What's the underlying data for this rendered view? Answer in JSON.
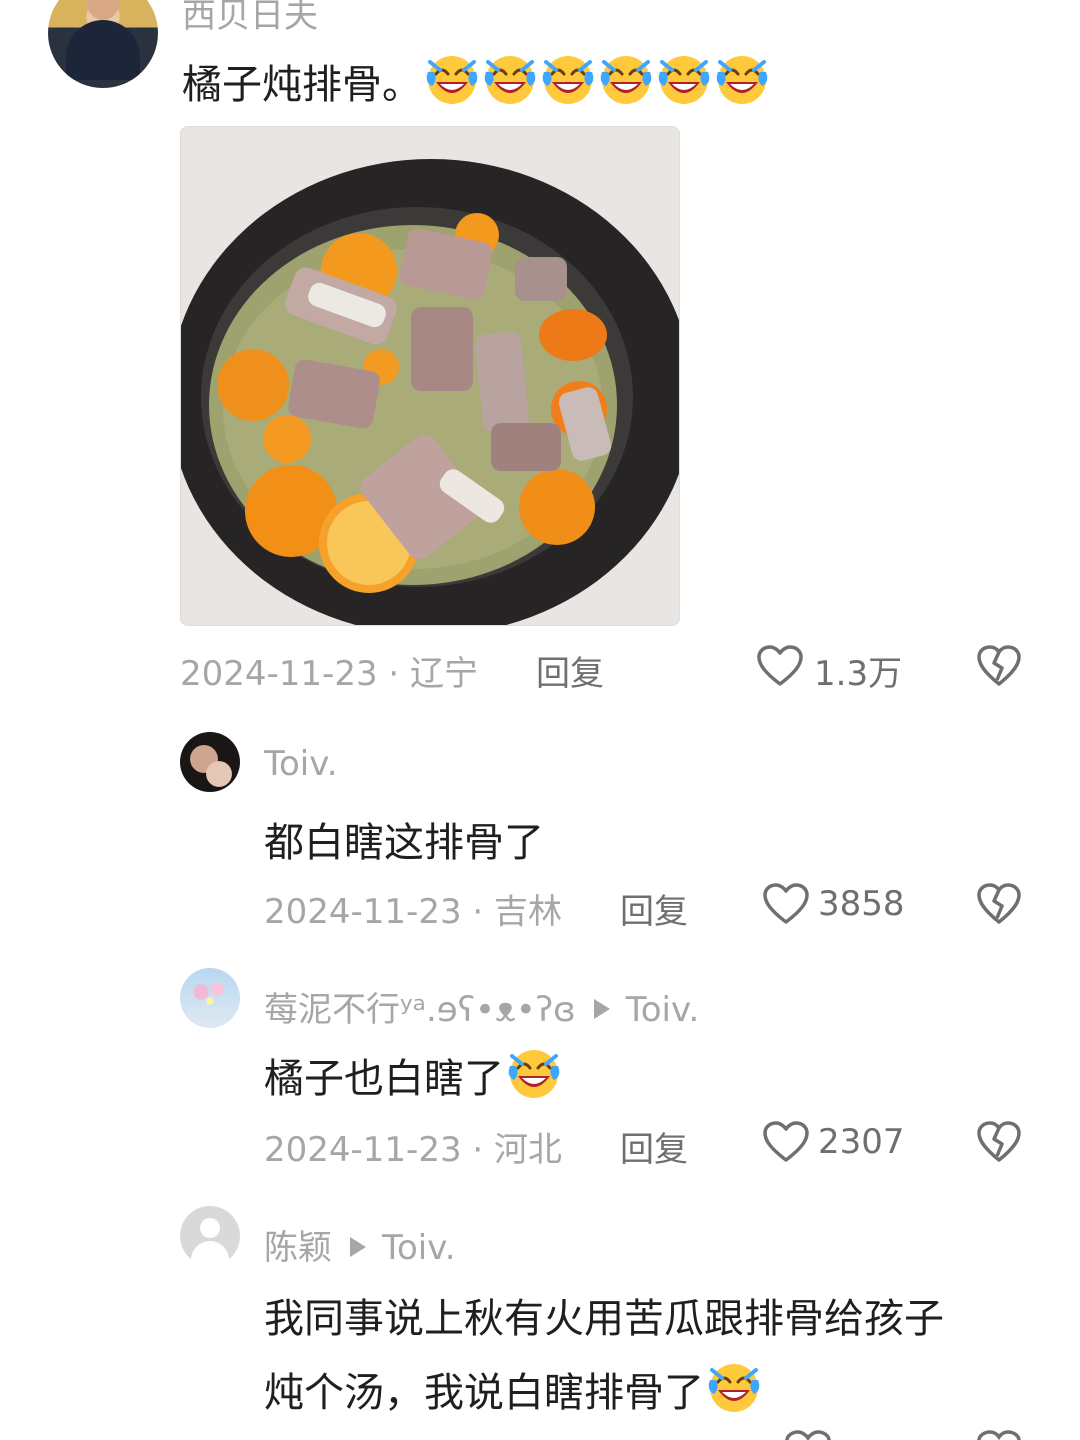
{
  "comments": [
    {
      "username": "西贝日夫",
      "text": "橘子炖排骨。",
      "emoji_count": 6,
      "emoji": "laughing-crying-emoji",
      "date_location": "2024-11-23 · 辽宁",
      "reply_label": "回复",
      "likes": "1.3万"
    },
    {
      "username": "Toiv.",
      "text": "都白瞎这排骨了",
      "date_location": "2024-11-23 · 吉林",
      "reply_label": "回复",
      "likes": "3858"
    },
    {
      "username": "莓泥不行ʸᵃ.ɘʕ•ᴥ•ʔɞ",
      "reply_to": "Toiv.",
      "text": "橘子也白瞎了",
      "emoji": "laughing-crying-emoji",
      "date_location": "2024-11-23 · 河北",
      "reply_label": "回复",
      "likes": "2307"
    },
    {
      "username": "陈颖",
      "reply_to": "Toiv.",
      "text_line1": "我同事说上秋有火用苦瓜跟排骨给孩子",
      "text_line2": "炖个汤，我说白瞎排骨了",
      "emoji": "laughing-crying-emoji"
    }
  ],
  "colors": {
    "primary_text": "#1f1f1f",
    "secondary_text": "#a6a6a6",
    "action_text": "#6f6f6f"
  }
}
